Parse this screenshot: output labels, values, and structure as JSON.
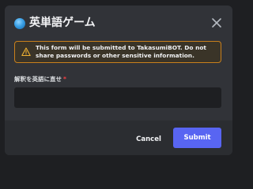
{
  "modal": {
    "title": "英単語ゲーム",
    "app_icon": "globe-icon",
    "close_icon": "close-icon"
  },
  "warning": {
    "icon": "warning-triangle-icon",
    "text": "This form will be submitted to TakasumiBOT. Do not share passwords or other sensitive information.",
    "border_color": "#c9801c"
  },
  "field": {
    "label": "解釈を英語に直せ",
    "required_mark": "*",
    "value": "",
    "placeholder": ""
  },
  "footer": {
    "cancel_label": "Cancel",
    "submit_label": "Submit"
  },
  "colors": {
    "background": "#313338",
    "input": "#1e1f22",
    "accent": "#5865f2",
    "required": "#f23f43"
  }
}
